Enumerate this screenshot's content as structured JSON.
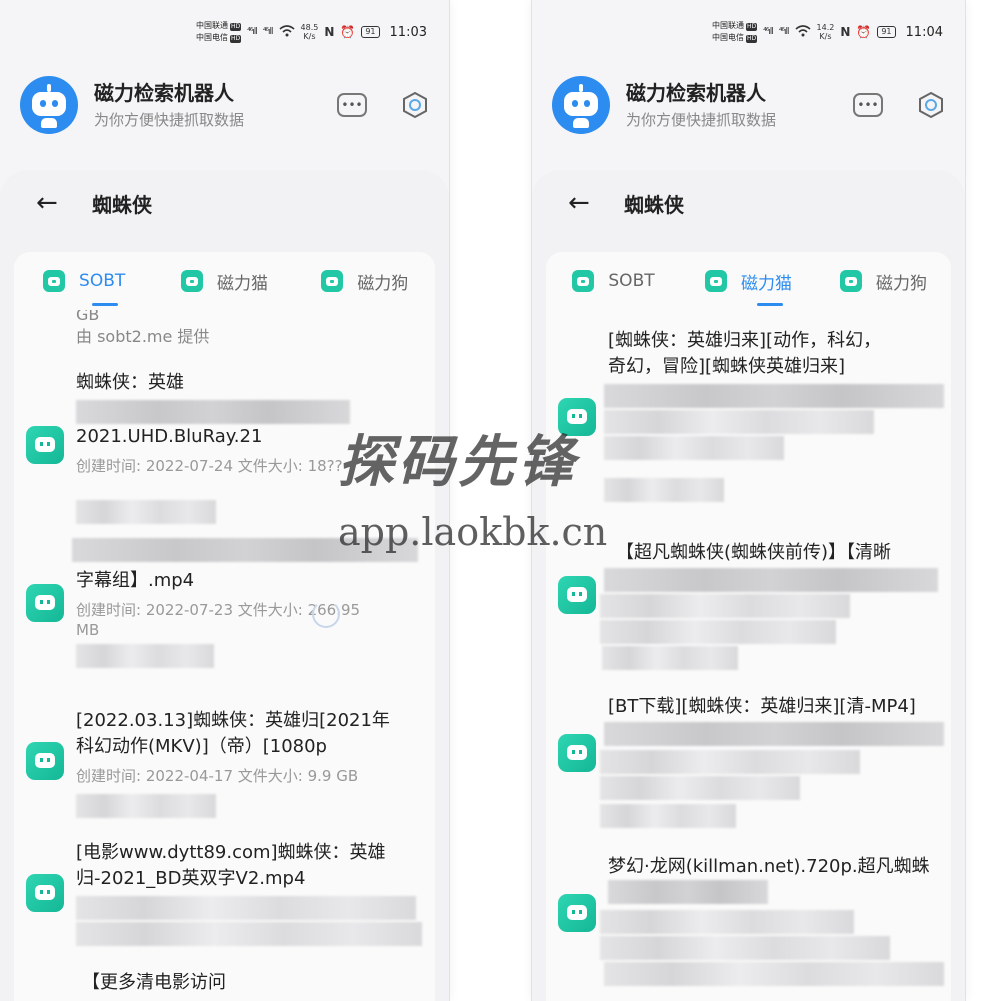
{
  "left": {
    "status": {
      "carrier1": "中国联通",
      "carrier2": "中国电信",
      "hd": "HD",
      "signal1": "⁴⁶ıll",
      "signal2": "⁴⁶ıll",
      "speed": "48.5",
      "speed_unit": "K/s",
      "battery": "91",
      "time": "11:03"
    },
    "header": {
      "title": "磁力检索机器人",
      "subtitle": "为你方便快捷抓取数据",
      "more_label": "•••"
    },
    "page": {
      "title": "蜘蛛侠"
    },
    "tabs": [
      {
        "label": "SOBT",
        "active": true
      },
      {
        "label": "磁力猫",
        "active": false
      },
      {
        "label": "磁力狗",
        "active": false
      }
    ],
    "top_fragment": {
      "size_tail": "GB",
      "provider": "由 sobt2.me 提供"
    },
    "items": [
      {
        "title_line1": "蜘蛛侠：英雄",
        "title_line2": "2021.UHD.BluRay.21",
        "meta": "创建时间:   2022-07-24 文件大小:  18??"
      },
      {
        "title_line1": "字幕组】.mp4",
        "meta": "创建时间:   2022-07-23 文件大小:  266.95",
        "meta2": "MB"
      },
      {
        "title_line1": "[2022.03.13]蜘蛛侠：英雄归[2021年",
        "title_line2": "科幻动作(MKV)]（帝）[1080p",
        "meta": "创建时间:   2022-04-17 文件大小:  9.9 GB"
      },
      {
        "title_line1": "[电影www.dytt89.com]蜘蛛侠：英雄",
        "title_line2": "归-2021_BD英双字V2.mp4"
      },
      {
        "title_line1": "【更多清电影访问"
      }
    ]
  },
  "right": {
    "status": {
      "carrier1": "中国联通",
      "carrier2": "中国电信",
      "hd": "HD",
      "signal1": "⁴⁶ıll",
      "signal2": "⁴⁶ıll",
      "speed": "14.2",
      "speed_unit": "K/s",
      "battery": "91",
      "time": "11:04"
    },
    "header": {
      "title": "磁力检索机器人",
      "subtitle": "为你方便快捷抓取数据",
      "more_label": "•••"
    },
    "page": {
      "title": "蜘蛛侠"
    },
    "tabs": [
      {
        "label": "SOBT",
        "active": false
      },
      {
        "label": "磁力猫",
        "active": true
      },
      {
        "label": "磁力狗",
        "active": false
      }
    ],
    "items": [
      {
        "title_line1": "[蜘蛛侠：英雄归来][动作，科幻，",
        "title_line2": "奇幻，冒险][蜘蛛侠英雄归来]"
      },
      {
        "title_line1": "【超凡蜘蛛侠(蜘蛛侠前传)】【清晰"
      },
      {
        "title_line1": "[BT下载][蜘蛛侠：英雄归来][清-MP4]"
      },
      {
        "title_line1": "梦幻·龙网(killman.net).720p.超凡蜘蛛"
      }
    ]
  },
  "watermark": {
    "line1": "探码先锋",
    "line2": "app.laokbk.cn"
  },
  "colors": {
    "accent": "#2d8cf0",
    "bot_green": "#22c7a5"
  },
  "icons": {
    "robot_avatar": "robot-avatar-icon",
    "more": "more-dots-icon",
    "target": "hexagon-target-icon",
    "back": "back-arrow-icon",
    "bot": "bot-icon"
  }
}
